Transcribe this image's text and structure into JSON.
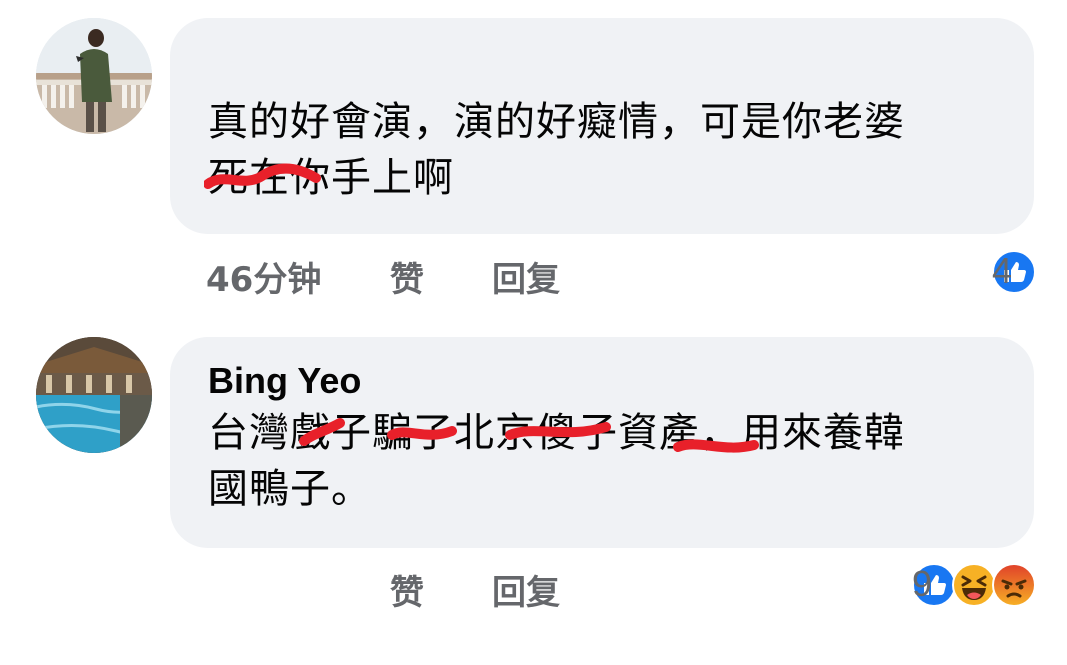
{
  "comments": [
    {
      "author": "",
      "text_line1": "真的好會演，演的好癡情，可是你老婆",
      "text_line2": "死在你手上啊",
      "time": "46分钟",
      "like_label": "赞",
      "reply_label": "回复",
      "reaction_count": "4",
      "reactions": [
        "like-icon"
      ]
    },
    {
      "author": "Bing Yeo",
      "text_line1": "台灣戲子騙了北京傻子資產，用來養韓",
      "text_line2": "國鴨子。",
      "like_label": "赞",
      "reply_label": "回复",
      "reaction_count": "9",
      "reactions": [
        "like-icon",
        "haha-icon",
        "angry-icon"
      ]
    }
  ],
  "colors": {
    "bubble": "#f0f2f5",
    "meta_text": "#65676b",
    "like_blue": "#1877f2",
    "haha_yellow": "#f7b125",
    "angry_orange": "#e9710f",
    "scribble_red": "#e8202a"
  }
}
